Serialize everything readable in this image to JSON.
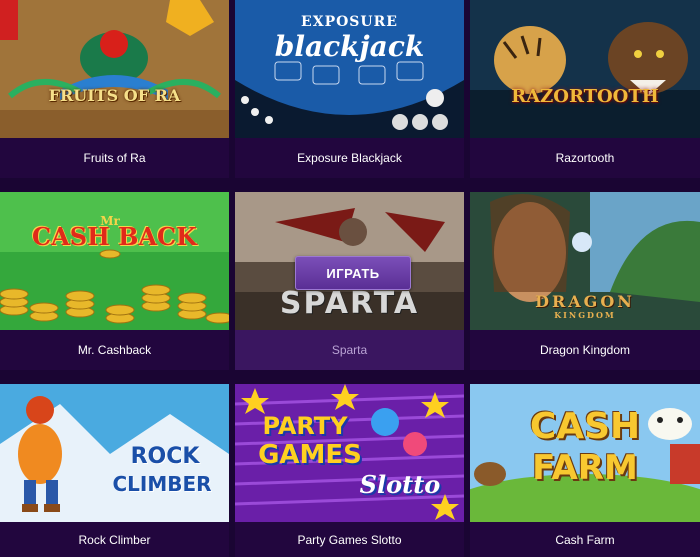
{
  "games": [
    {
      "id": "fruits-of-ra",
      "caption": "Fruits of Ra",
      "logo": "FRUITS OF RA"
    },
    {
      "id": "exposure-blackjack",
      "caption": "Exposure Blackjack",
      "logo_top": "EXPOSURE",
      "logo_main": "blackjack"
    },
    {
      "id": "razortooth",
      "caption": "Razortooth",
      "logo": "RAZORTOOTH"
    },
    {
      "id": "mr-cashback",
      "caption": "Mr. Cashback",
      "logo_small": "Mr",
      "logo_main": "CASH BACK"
    },
    {
      "id": "sparta",
      "caption": "Sparta",
      "logo": "SPARTA",
      "play_label": "ИГРАТЬ"
    },
    {
      "id": "dragon-kingdom",
      "caption": "Dragon Kingdom",
      "logo": "DRAGON",
      "logo_sub": "KINGDOM"
    },
    {
      "id": "rock-climber",
      "caption": "Rock Climber",
      "logo_line1": "ROCK",
      "logo_line2": "CLIMBER"
    },
    {
      "id": "party-games-slotto",
      "caption": "Party Games Slotto",
      "logo_line1": "PARTY",
      "logo_line2": "GAMES",
      "logo_line3": "Slotto"
    },
    {
      "id": "cash-farm",
      "caption": "Cash Farm",
      "logo_line1": "CASH",
      "logo_line2": "FARM"
    }
  ],
  "colors": {
    "page_bg": "#1a0533",
    "caption_bg": "#22063e",
    "caption_hover_bg": "#3a1660",
    "play_button": "#6a3ea8"
  }
}
